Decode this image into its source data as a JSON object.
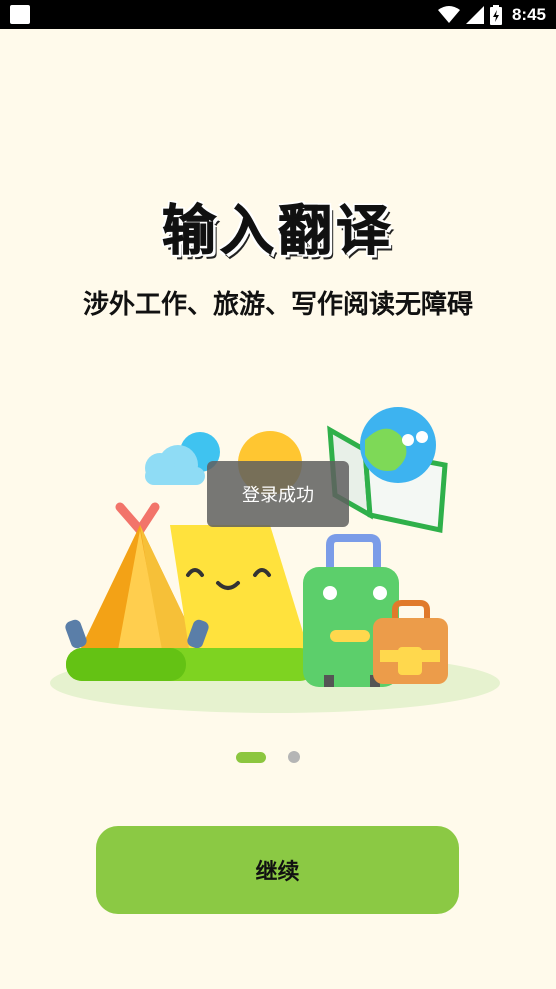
{
  "status_bar": {
    "time": "8:45"
  },
  "onboarding": {
    "title": "输入翻译",
    "subtitle": "涉外工作、旅游、写作阅读无障碍",
    "page_indicator": {
      "current": 1,
      "total": 2
    }
  },
  "toast": {
    "message": "登录成功"
  },
  "actions": {
    "continue_label": "继续"
  },
  "colors": {
    "background": "#fffaeb",
    "accent": "#8bc944",
    "toast_bg": "#5f5f5f"
  }
}
